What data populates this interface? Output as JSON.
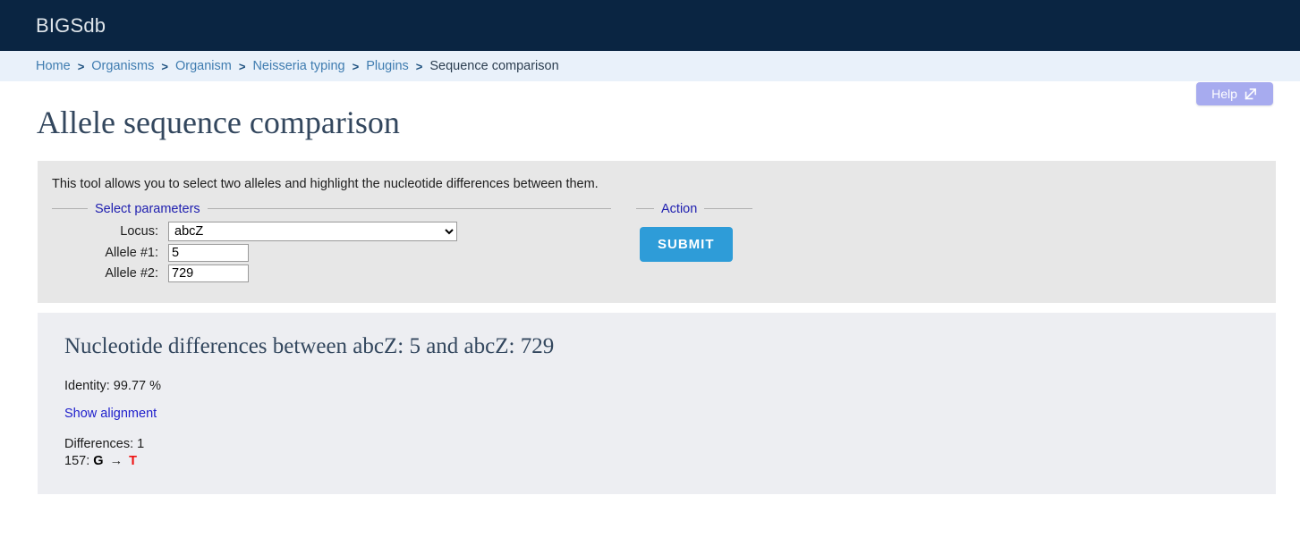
{
  "header": {
    "site_title": "BIGSdb",
    "bg_color": "#0a2542"
  },
  "breadcrumb": {
    "separator": ">",
    "items": [
      {
        "label": "Home",
        "is_link": true
      },
      {
        "label": "Organisms",
        "is_link": true
      },
      {
        "label": "Organism",
        "is_link": true
      },
      {
        "label": "Neisseria typing",
        "is_link": true
      },
      {
        "label": "Plugins",
        "is_link": true
      },
      {
        "label": "Sequence comparison",
        "is_link": false
      }
    ]
  },
  "help": {
    "label": "Help",
    "icon": "external-link-icon",
    "bg_color": "#a7abef"
  },
  "page": {
    "title": "Allele sequence comparison",
    "title_color": "#33475e"
  },
  "params_panel": {
    "intro": "This tool allows you to select two alleles and highlight the nucleotide differences between them.",
    "select_parameters_legend": "Select parameters",
    "action_legend": "Action",
    "fields": {
      "locus_label": "Locus:",
      "locus_value": "abcZ",
      "locus_options": [
        "abcZ"
      ],
      "allele1_label": "Allele #1:",
      "allele1_value": "5",
      "allele2_label": "Allele #2:",
      "allele2_value": "729"
    },
    "submit_label": "SUBMIT",
    "submit_color": "#2e9cd8"
  },
  "results_panel": {
    "heading": "Nucleotide differences between abcZ: 5 and abcZ: 729",
    "identity": "Identity: 99.77 %",
    "show_alignment_label": "Show alignment",
    "differences_label": "Differences: 1",
    "difference_rows": [
      {
        "position": "157:",
        "from_base": "G",
        "arrow": "→",
        "to_base": "T",
        "to_color": "#ee1111"
      }
    ]
  }
}
